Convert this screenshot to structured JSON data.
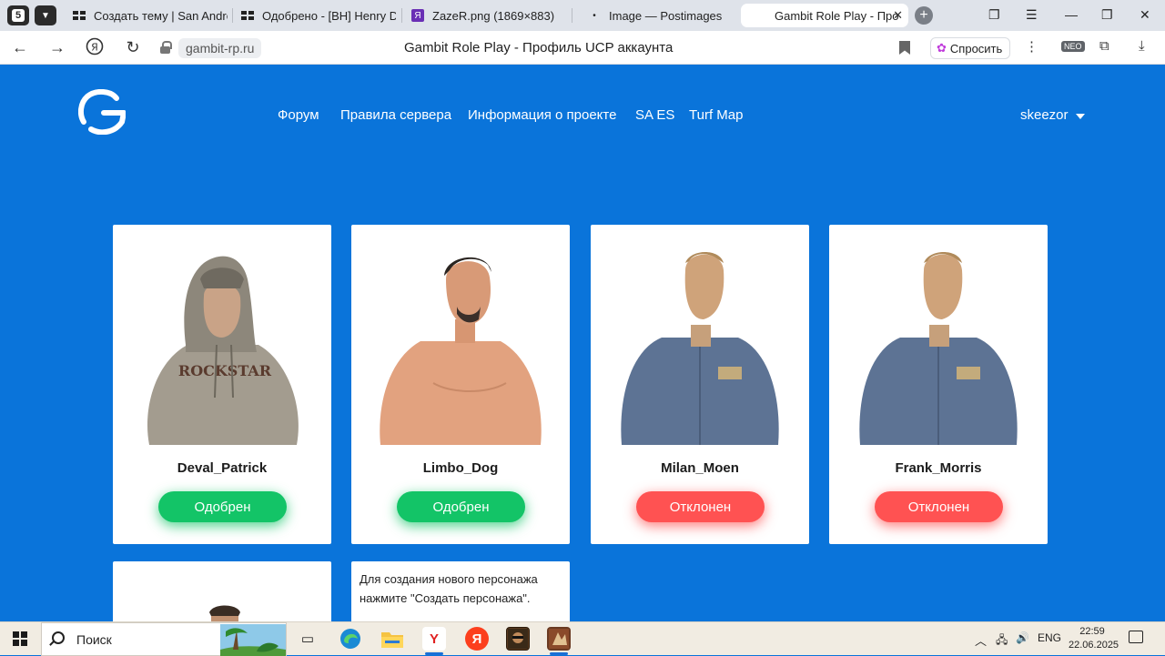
{
  "browser": {
    "tab_count": "5",
    "tabs": [
      {
        "label": "Создать тему | San Andre",
        "favicon": "gambit-forum-icon"
      },
      {
        "label": "Одобрено - [BH] Henry D",
        "favicon": "gambit-forum-icon"
      },
      {
        "label": "ZazeR.png (1869×883)",
        "favicon": "yandex-icon"
      },
      {
        "label": "Image — Postimages",
        "favicon": "postimages-icon"
      },
      {
        "label": "Gambit Role Play - Про",
        "favicon": "gambit-icon"
      }
    ],
    "domain": "gambit-rp.ru",
    "page_title": "Gambit Role Play - Профиль UCP аккаунта",
    "ask_label": "Спросить",
    "neo_label": "NEO"
  },
  "site": {
    "nav": [
      "Форум",
      "Правила сервера",
      "Информация о проекте",
      "SA ES",
      "Turf Map"
    ],
    "username": "skeezor"
  },
  "characters": [
    {
      "name": "Deval_Patrick",
      "status": "Одобрен",
      "status_type": "approved"
    },
    {
      "name": "Limbo_Dog",
      "status": "Одобрен",
      "status_type": "approved"
    },
    {
      "name": "Milan_Moen",
      "status": "Отклонен",
      "status_type": "rejected"
    },
    {
      "name": "Frank_Morris",
      "status": "Отклонен",
      "status_type": "rejected"
    }
  ],
  "info_card": {
    "text": "Для создания нового персонажа нажмите \"Создать персонажа\"."
  },
  "taskbar": {
    "search_placeholder": "Поиск",
    "language": "ENG",
    "time": "22:59",
    "date": "22.06.2025"
  },
  "colors": {
    "page_bg": "#0a74da",
    "approved": "#13c467",
    "rejected": "#ff5252"
  }
}
